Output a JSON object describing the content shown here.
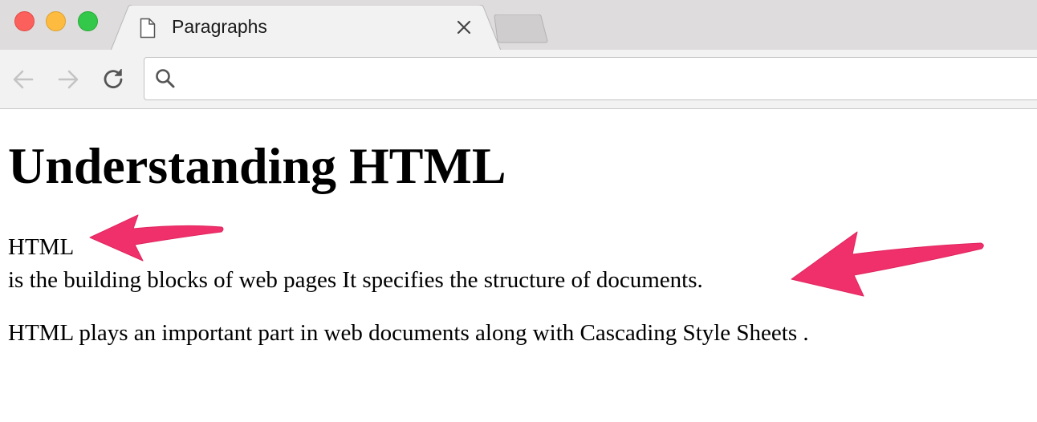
{
  "window": {
    "controls": [
      "close-control",
      "minimize-control",
      "zoom-control"
    ]
  },
  "tab": {
    "title": "Paragraphs",
    "icon": "document-icon"
  },
  "toolbar": {
    "back_icon": "arrow-left-icon",
    "forward_icon": "arrow-right-icon",
    "reload_icon": "reload-icon"
  },
  "omnibox": {
    "value": "",
    "icon": "search-icon"
  },
  "page": {
    "heading": "Understanding HTML",
    "paragraph1_term": "HTML",
    "paragraph1_text": "is the building blocks of web pages It specifies the structure of documents.",
    "paragraph2_text": "HTML plays an important part in web documents along with Cascading Style Sheets ."
  },
  "annotations": {
    "arrow_color": "#f0306a"
  }
}
